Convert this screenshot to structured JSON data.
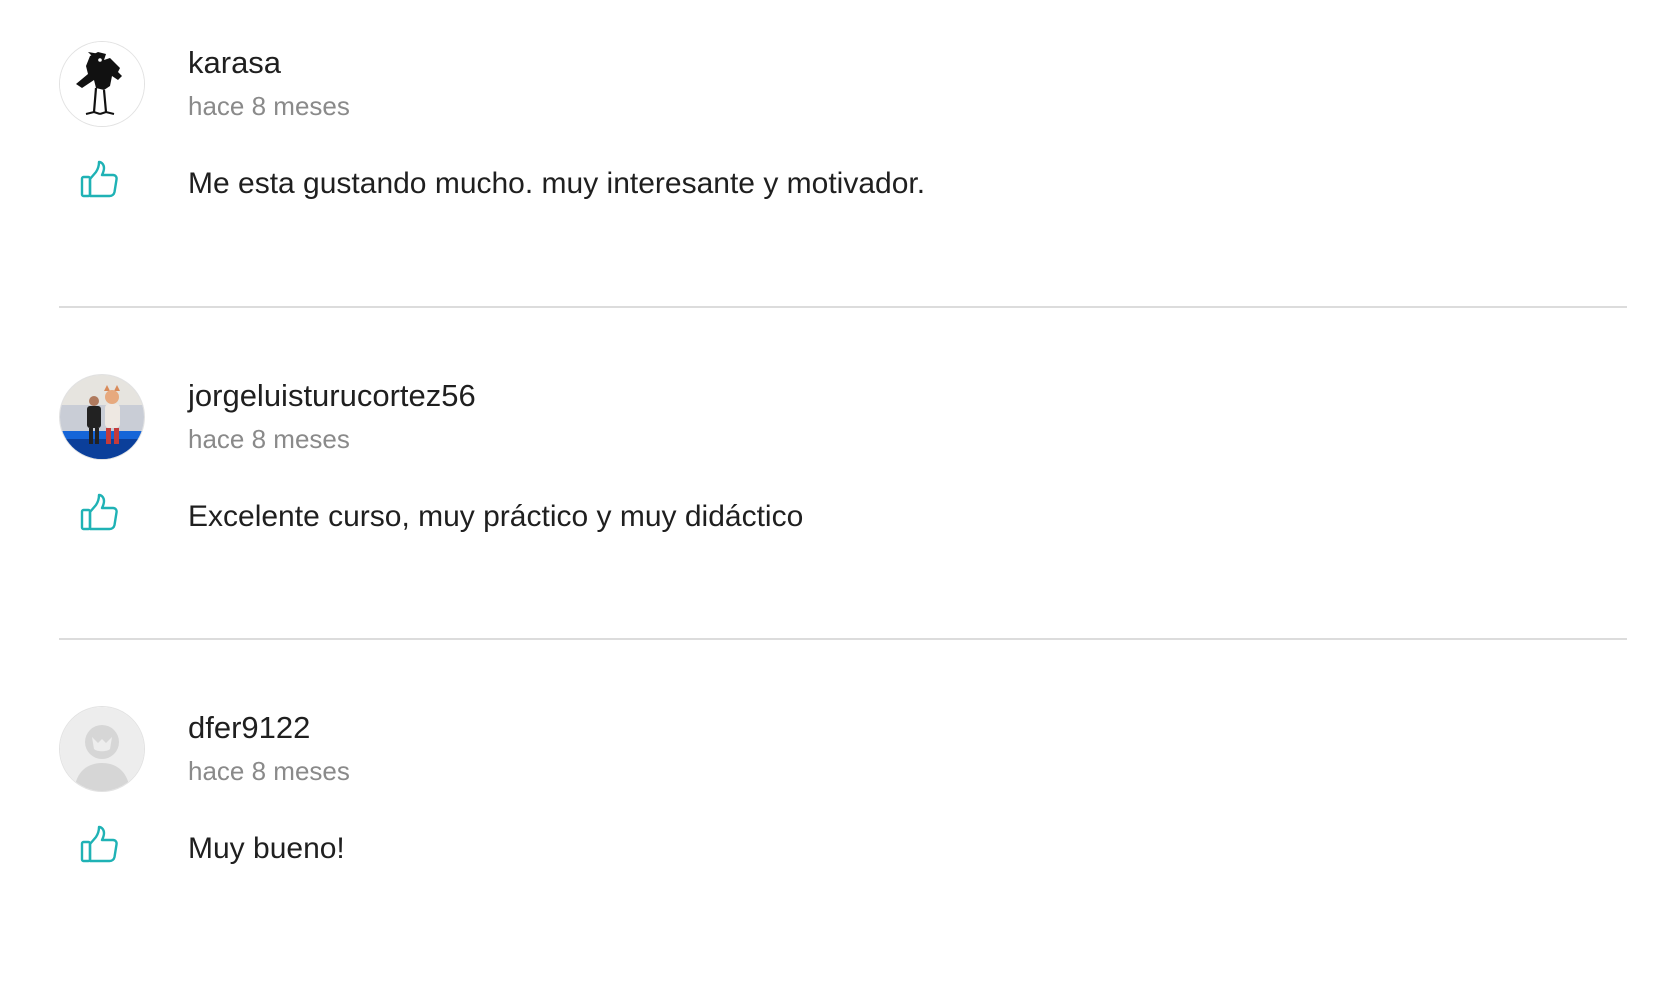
{
  "colors": {
    "accent": "#1fb2b5",
    "username_text": "#1f1f1f",
    "time_text": "#8a8a8a",
    "divider": "#dcdcdc"
  },
  "reviews": [
    {
      "username": "karasa",
      "time_ago": "hace 8 meses",
      "comment": "Me esta gustando mucho. muy interesante y motivador.",
      "avatar_icon": "bird-avatar-icon",
      "like_icon": "thumbs-up-icon"
    },
    {
      "username": "jorgeluisturucortez56",
      "time_ago": "hace 8 meses",
      "comment": "Excelente curso, muy práctico y muy didáctico",
      "avatar_icon": "photo-avatar",
      "like_icon": "thumbs-up-icon"
    },
    {
      "username": "dfer9122",
      "time_ago": "hace 8 meses",
      "comment": "Muy bueno!",
      "avatar_icon": "default-user-avatar-icon",
      "like_icon": "thumbs-up-icon"
    }
  ]
}
